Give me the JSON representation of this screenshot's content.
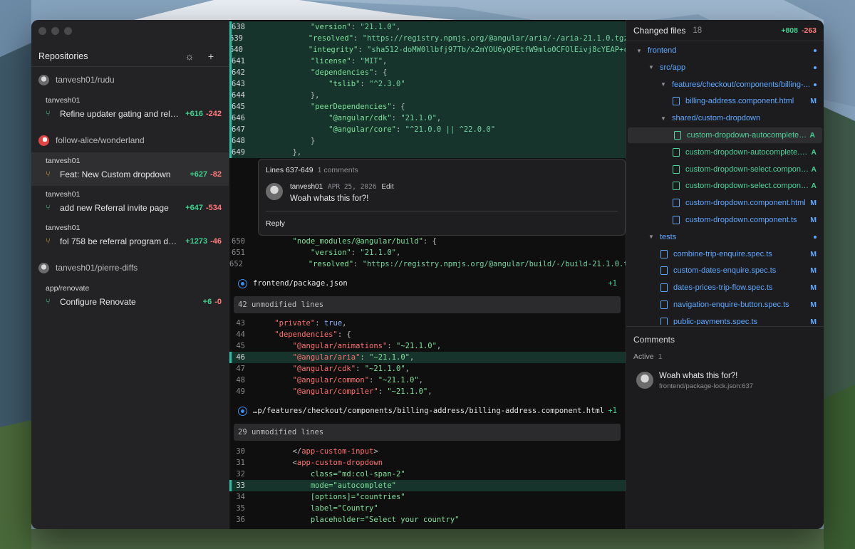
{
  "sidebar": {
    "title": "Repositories",
    "repos": [
      {
        "name": "tanvesh01/rudu",
        "prs": [
          {
            "author": "tanvesh01",
            "title": "Refine updater gating and rele...",
            "add": "+616",
            "del": "-242",
            "kind": "open"
          }
        ]
      },
      {
        "name": "follow-alice/wonderland",
        "prs": [
          {
            "author": "tanvesh01",
            "title": "Feat: New Custom dropdown",
            "add": "+627",
            "del": "-82",
            "kind": "draft"
          },
          {
            "author": "tanvesh01",
            "title": "add new Referral invite page",
            "add": "+647",
            "del": "-534",
            "kind": "open"
          },
          {
            "author": "tanvesh01",
            "title": "fol 758 be referral program das...",
            "add": "+1273",
            "del": "-46",
            "kind": "draft"
          }
        ]
      },
      {
        "name": "tanvesh01/pierre-diffs",
        "prs": [
          {
            "author": "app/renovate",
            "title": "Configure Renovate",
            "add": "+6",
            "del": "-0",
            "kind": "open"
          }
        ]
      }
    ]
  },
  "diff": {
    "top_lines": [
      {
        "n": "638",
        "indent": "            ",
        "key": "\"version\"",
        "sep": ": ",
        "val": "\"21.1.0\"",
        "end": ","
      },
      {
        "n": "639",
        "indent": "            ",
        "key": "\"resolved\"",
        "sep": ": ",
        "val": "\"https://registry.npmjs.org/@angular/aria/-/aria-21.1.0.tgz\"",
        "end": ""
      },
      {
        "n": "640",
        "indent": "            ",
        "key": "\"integrity\"",
        "sep": ": ",
        "val": "\"sha512-doMW0llbfj97Tb/x2mYOU6yQPEtfW9mlo0CFOlEivj8cYEAP+c",
        "end": ""
      },
      {
        "n": "641",
        "indent": "            ",
        "key": "\"license\"",
        "sep": ": ",
        "val": "\"MIT\"",
        "end": ","
      },
      {
        "n": "642",
        "indent": "            ",
        "key": "\"dependencies\"",
        "sep": ": {",
        "val": "",
        "end": ""
      },
      {
        "n": "643",
        "indent": "                ",
        "key": "\"tslib\"",
        "sep": ": ",
        "val": "\"^2.3.0\"",
        "end": ""
      },
      {
        "n": "644",
        "indent": "            ",
        "key": "",
        "sep": "},",
        "val": "",
        "end": ""
      },
      {
        "n": "645",
        "indent": "            ",
        "key": "\"peerDependencies\"",
        "sep": ": {",
        "val": "",
        "end": ""
      },
      {
        "n": "646",
        "indent": "                ",
        "key": "\"@angular/cdk\"",
        "sep": ": ",
        "val": "\"21.1.0\"",
        "end": ","
      },
      {
        "n": "647",
        "indent": "                ",
        "key": "\"@angular/core\"",
        "sep": ": ",
        "val": "\"^21.0.0 || ^22.0.0\"",
        "end": ""
      },
      {
        "n": "648",
        "indent": "            ",
        "key": "",
        "sep": "}",
        "val": "",
        "end": ""
      },
      {
        "n": "649",
        "indent": "        ",
        "key": "",
        "sep": "},",
        "val": "",
        "end": ""
      }
    ],
    "comment": {
      "range": "Lines 637-649",
      "count": "1 comments",
      "author": "tanvesh01",
      "date": "APR 25, 2026",
      "edit": "Edit",
      "text": "Woah whats this for?!",
      "reply": "Reply"
    },
    "mid_lines": [
      {
        "n": "650",
        "indent": "        ",
        "key": "\"node_modules/@angular/build\"",
        "sep": ": {",
        "val": "",
        "end": ""
      },
      {
        "n": "651",
        "indent": "            ",
        "key": "\"version\"",
        "sep": ": ",
        "val": "\"21.1.0\"",
        "end": ","
      },
      {
        "n": "652",
        "indent": "            ",
        "key": "\"resolved\"",
        "sep": ": ",
        "val": "\"https://registry.npmjs.org/@angular/build/-/build-21.1.0.t",
        "end": ""
      }
    ],
    "file1": {
      "name": "frontend/package.json",
      "count": "+1",
      "unmodified": "42 unmodified lines"
    },
    "file1_lines": [
      {
        "n": "43",
        "indent": "    ",
        "key": "\"private\"",
        "sep": ": ",
        "val": "true",
        "end": ",",
        "bool": true
      },
      {
        "n": "44",
        "indent": "    ",
        "key": "\"dependencies\"",
        "sep": ": {",
        "val": "",
        "end": ""
      },
      {
        "n": "45",
        "indent": "        ",
        "key": "\"@angular/animations\"",
        "sep": ": ",
        "val": "\"~21.1.0\"",
        "end": ","
      },
      {
        "n": "46",
        "indent": "        ",
        "key": "\"@angular/aria\"",
        "sep": ": ",
        "val": "\"~21.1.0\"",
        "end": ",",
        "hl": true
      },
      {
        "n": "47",
        "indent": "        ",
        "key": "\"@angular/cdk\"",
        "sep": ": ",
        "val": "\"~21.1.0\"",
        "end": ","
      },
      {
        "n": "48",
        "indent": "        ",
        "key": "\"@angular/common\"",
        "sep": ": ",
        "val": "\"~21.1.0\"",
        "end": ","
      },
      {
        "n": "49",
        "indent": "        ",
        "key": "\"@angular/compiler\"",
        "sep": ": ",
        "val": "\"~21.1.0\"",
        "end": ","
      }
    ],
    "file2": {
      "name": "…p/features/checkout/components/billing-address/billing-address.component.html",
      "count": "+1",
      "unmodified": "29 unmodified lines"
    },
    "file2_lines": [
      {
        "n": "30",
        "html": "        <span class=\"p\">&lt;/</span><span class=\"tag\">app-custom-input</span><span class=\"p\">&gt;</span>"
      },
      {
        "n": "31",
        "html": "        <span class=\"p\">&lt;</span><span class=\"tag\">app-custom-dropdown</span>"
      },
      {
        "n": "32",
        "html": "            <span class=\"attr\">class=\"md:col-span-2\"</span>"
      },
      {
        "n": "33",
        "html": "            <span class=\"attr\">mode=\"autocomplete\"</span>",
        "hl": true
      },
      {
        "n": "34",
        "html": "            <span class=\"attr\">[options]=\"countries\"</span>"
      },
      {
        "n": "35",
        "html": "            <span class=\"attr\">label=\"Country\"</span>"
      },
      {
        "n": "36",
        "html": "            <span class=\"attr\">placeholder=\"Select your country\"</span>"
      }
    ]
  },
  "changed": {
    "title": "Changed files",
    "count": "18",
    "add": "+808",
    "del": "-263",
    "tree": [
      {
        "label": "frontend",
        "type": "folder",
        "depth": 0,
        "status": "dot"
      },
      {
        "label": "src/app",
        "type": "folder",
        "depth": 1,
        "status": "dot"
      },
      {
        "label": "features/checkout/components/billing-...",
        "type": "folder",
        "depth": 2,
        "status": "dot"
      },
      {
        "label": "billing-address.component.html",
        "type": "file",
        "depth": 3,
        "status": "M"
      },
      {
        "label": "shared/custom-dropdown",
        "type": "folder",
        "depth": 2,
        "status": ""
      },
      {
        "label": "custom-dropdown-autocomplete.c...",
        "type": "file",
        "depth": 3,
        "status": "A",
        "sel": true
      },
      {
        "label": "custom-dropdown-autocomplete.c...",
        "type": "file",
        "depth": 3,
        "status": "A"
      },
      {
        "label": "custom-dropdown-select.compone...",
        "type": "file",
        "depth": 3,
        "status": "A"
      },
      {
        "label": "custom-dropdown-select.compone...",
        "type": "file",
        "depth": 3,
        "status": "A"
      },
      {
        "label": "custom-dropdown.component.html",
        "type": "file",
        "depth": 3,
        "status": "M"
      },
      {
        "label": "custom-dropdown.component.ts",
        "type": "file",
        "depth": 3,
        "status": "M"
      },
      {
        "label": "tests",
        "type": "folder",
        "depth": 1,
        "status": "dot"
      },
      {
        "label": "combine-trip-enquire.spec.ts",
        "type": "file",
        "depth": 2,
        "status": "M"
      },
      {
        "label": "custom-dates-enquire.spec.ts",
        "type": "file",
        "depth": 2,
        "status": "M"
      },
      {
        "label": "dates-prices-trip-flow.spec.ts",
        "type": "file",
        "depth": 2,
        "status": "M"
      },
      {
        "label": "navigation-enquire-button.spec.ts",
        "type": "file",
        "depth": 2,
        "status": "M"
      },
      {
        "label": "public-payments.spec.ts",
        "type": "file",
        "depth": 2,
        "status": "M"
      }
    ]
  },
  "comments": {
    "title": "Comments",
    "active_label": "Active",
    "active_count": "1",
    "items": [
      {
        "text": "Woah whats this for?!",
        "path": "frontend/package-lock.json:637"
      }
    ]
  },
  "icons": {
    "settings": "sun-gear-icon",
    "add": "plus-icon",
    "pr_open": "pull-request-icon",
    "pr_draft": "draft-pr-icon",
    "file": "file-icon",
    "folder_chevron": "chevron-down-icon"
  },
  "colors": {
    "accent": "#20c3a3",
    "add": "#3fd18f",
    "del": "#ff7a7a",
    "modified": "#5fa8ff"
  }
}
